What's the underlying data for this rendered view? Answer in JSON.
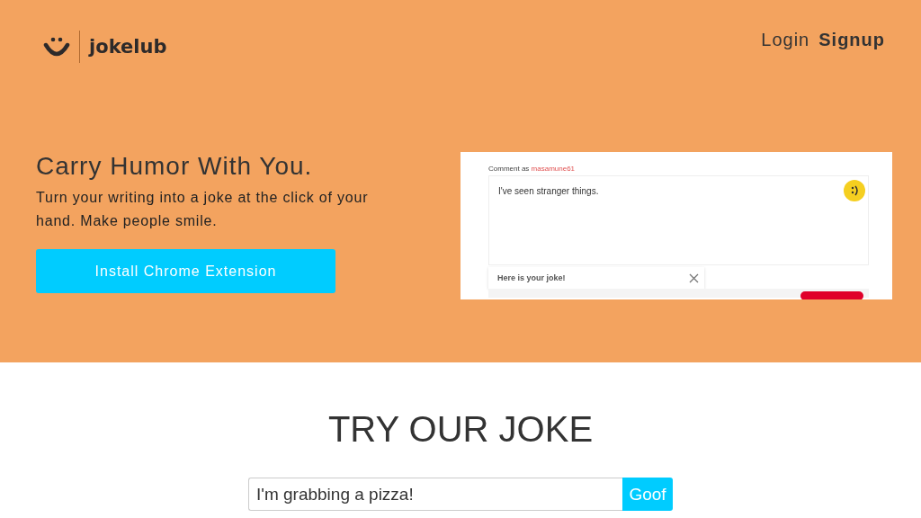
{
  "header": {
    "logo": "jokelub",
    "nav": [
      {
        "label": "Login",
        "bold": false
      },
      {
        "label": "Signup",
        "bold": true
      }
    ]
  },
  "hero": {
    "title": "Carry Humor With You.",
    "text": "Turn your writing into a joke at the click of your hand. Make people smile.",
    "button": "Install Chrome Extension",
    "demo": {
      "comment_label": "Comment as",
      "username": "masamune61",
      "comment": "I've seen stranger things.",
      "popup": "Here is your joke!"
    }
  },
  "try": {
    "title": "TRY OUR JOKE",
    "input": {
      "value": "I'm grabbing a pizza!"
    },
    "button": "Goof"
  }
}
